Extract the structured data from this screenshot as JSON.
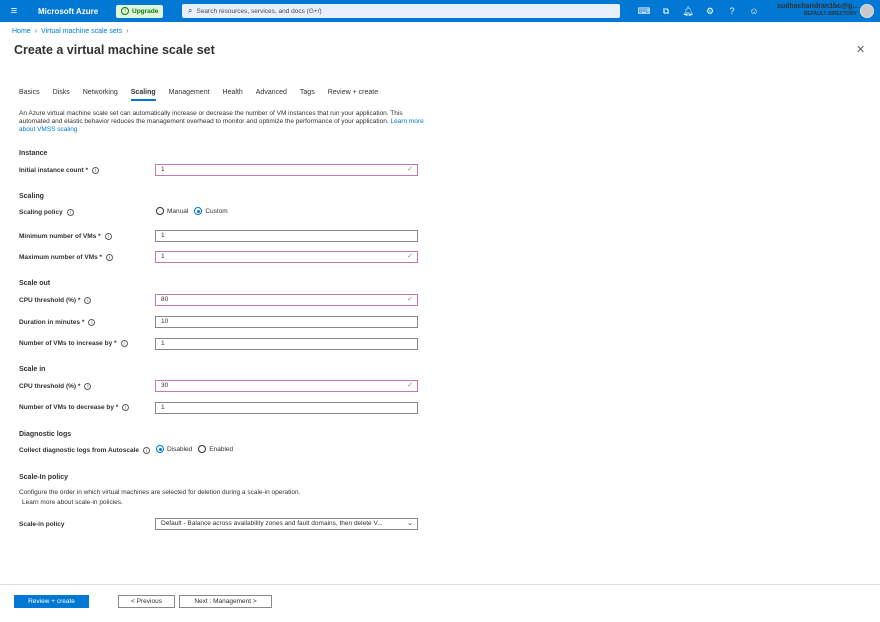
{
  "topbar": {
    "menu_icon": "hamburger-icon",
    "brand": "Microsoft Azure",
    "upgrade": "Upgrade",
    "search_placeholder": "Search resources, services, and docs (G+/)",
    "icons": [
      "cloud-shell-icon",
      "directory-filter-icon",
      "notifications-icon",
      "settings-icon",
      "help-icon",
      "feedback-icon"
    ],
    "user": "sudhachandran1bc@g...",
    "directory": "DEFAULT DIRECTORY",
    "accent": "#0078d4"
  },
  "breadcrumb": [
    "Home",
    "Virtual machine scale sets"
  ],
  "page": {
    "title": "Create a virtual machine scale set"
  },
  "tabs": [
    "Basics",
    "Disks",
    "Networking",
    "Scaling",
    "Management",
    "Health",
    "Advanced",
    "Tags",
    "Review + create"
  ],
  "active_tab": "Scaling",
  "description": {
    "text": "An Azure virtual machine scale set can automatically increase or decrease the number of VM instances that run your application. This automated and elastic behavior reduces the management overhead to monitor and optimize the performance of your application.",
    "link": "Learn more about VMSS scaling"
  },
  "instance": {
    "heading": "Instance",
    "initial_label": "Initial instance count",
    "initial_value": "1"
  },
  "scaling": {
    "heading": "Scaling",
    "policy_label": "Scaling policy",
    "policy_options": [
      "Manual",
      "Custom"
    ],
    "policy_selected": "Custom",
    "min_label": "Minimum number of VMs",
    "min_value": "1",
    "max_label": "Maximum number of VMs",
    "max_value": "1"
  },
  "scale_out": {
    "heading": "Scale out",
    "cpu_label": "CPU threshold (%)",
    "cpu_value": "80",
    "duration_label": "Duration in minutes",
    "duration_value": "10",
    "increase_label": "Number of VMs to increase by",
    "increase_value": "1"
  },
  "scale_in": {
    "heading": "Scale in",
    "cpu_label": "CPU threshold (%)",
    "cpu_value": "30",
    "decrease_label": "Number of VMs to decrease by",
    "decrease_value": "1"
  },
  "diagnostic": {
    "heading": "Diagnostic logs",
    "collect_label": "Collect diagnostic logs from Autoscale",
    "options": [
      "Disabled",
      "Enabled"
    ],
    "selected": "Disabled"
  },
  "scale_in_policy": {
    "heading": "Scale-In policy",
    "desc": "Configure the order in which virtual machines are selected for deletion during a scale-in operation.",
    "link": "Learn more about scale-in policies.",
    "label": "Scale-in policy",
    "value": "Default - Balance across availability zones and fault domains, then delete V..."
  },
  "footer": {
    "review": "Review + create",
    "previous": "< Previous",
    "next": "Next : Management >"
  }
}
